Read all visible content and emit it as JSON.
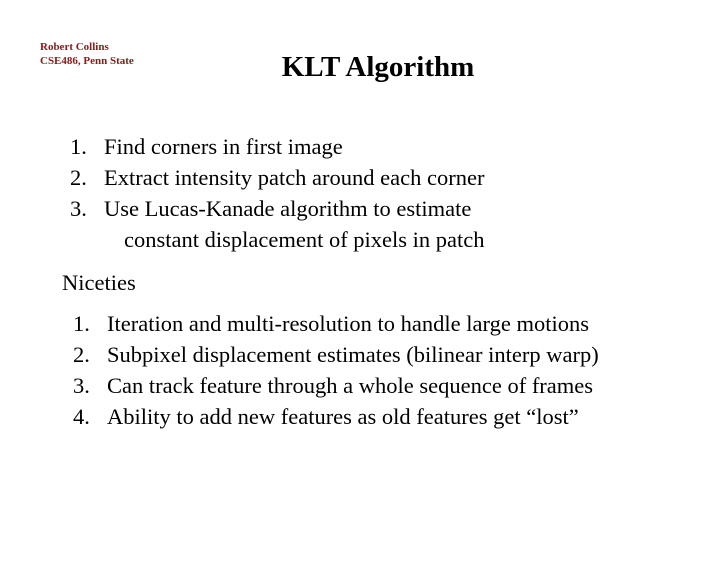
{
  "header": {
    "author": "Robert Collins",
    "course": "CSE486, Penn State"
  },
  "title": "KLT Algorithm",
  "steps": [
    {
      "num": "1.",
      "text": "Find corners in first image"
    },
    {
      "num": "2.",
      "text": "Extract intensity patch around each corner"
    },
    {
      "num": "3.",
      "text": "Use Lucas-Kanade algorithm to estimate",
      "continuation": "constant displacement of pixels in patch"
    }
  ],
  "niceties": {
    "heading": "Niceties",
    "items": [
      {
        "num": "1.",
        "text": "Iteration and multi-resolution to handle large motions"
      },
      {
        "num": "2.",
        "text": "Subpixel displacement estimates (bilinear interp warp)"
      },
      {
        "num": "3.",
        "text": "Can track feature through a whole sequence of frames"
      },
      {
        "num": "4.",
        "text": "Ability to add new features as old features get “lost”"
      }
    ]
  },
  "colors": {
    "author": "#8b1a1a",
    "text": "#000000"
  }
}
